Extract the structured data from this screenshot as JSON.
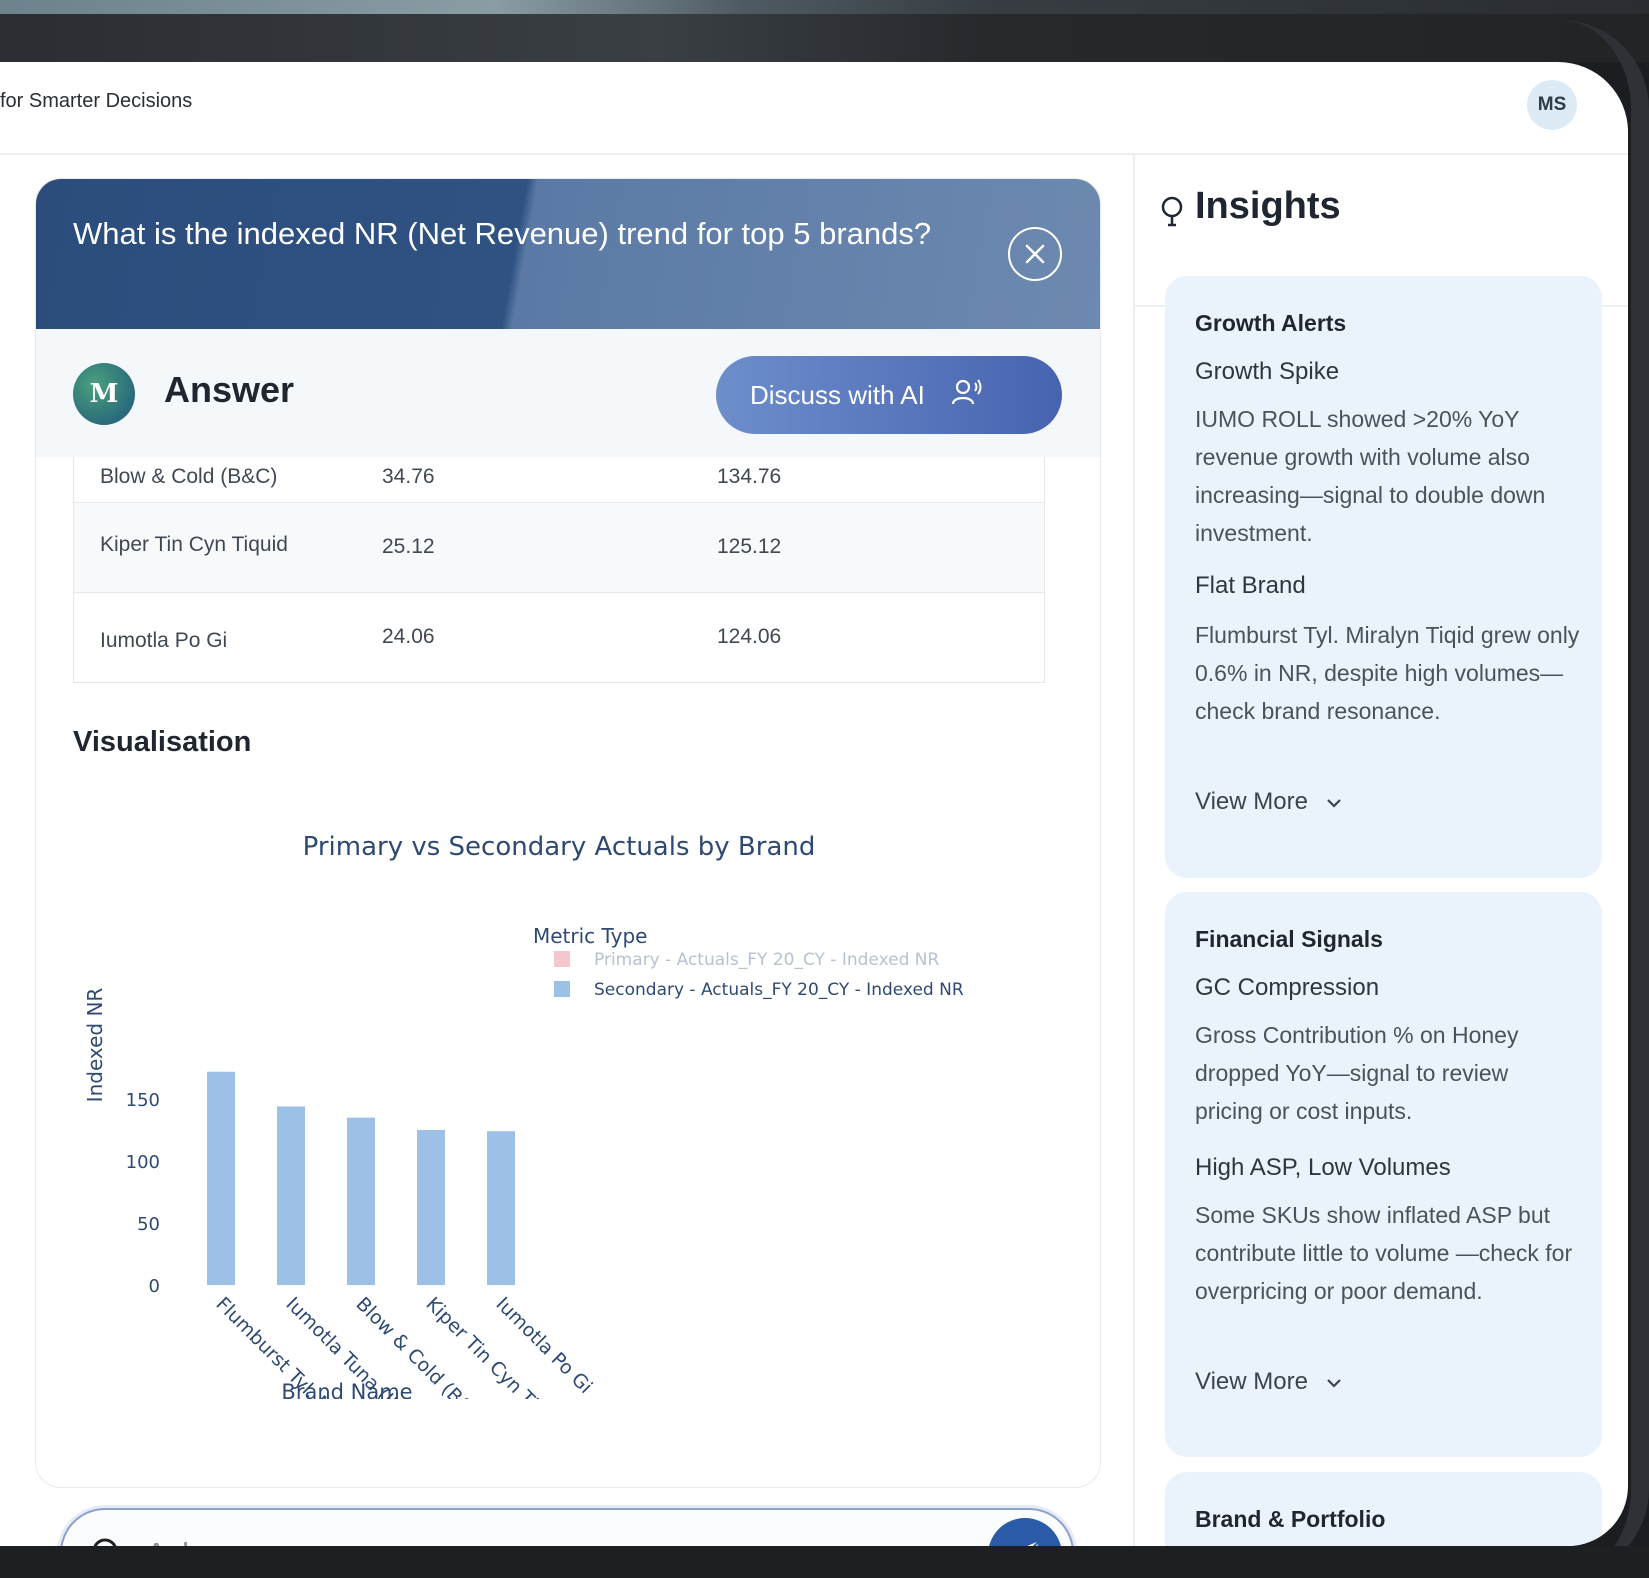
{
  "header": {
    "tagline": "for Smarter Decisions",
    "avatar_initials": "MS"
  },
  "question": {
    "text": "What is the indexed NR (Net Revenue) trend for top 5 brands?"
  },
  "answer": {
    "label": "Answer",
    "logo_letter": "M",
    "discuss_button": "Discuss with AI"
  },
  "table": {
    "rows": [
      [
        "Blow & Cold (B&C)",
        "34.76",
        "134.76"
      ],
      [
        "Kiper Tin Cyn Tiquid",
        "25.12",
        "125.12"
      ],
      [
        "Iumotla Po Gi",
        "24.06",
        "124.06"
      ]
    ]
  },
  "visualisation": {
    "heading": "Visualisation"
  },
  "chart_data": {
    "type": "bar",
    "title": "Primary vs Secondary Actuals by Brand",
    "xlabel": "Brand Name",
    "ylabel": "Indexed NR",
    "categories": [
      "Flumburst Tyl. Miralyn Tiqid",
      "Iumotla Tuna (IUMO TUNA)",
      "Blow & Cold (B&C)",
      "Kiper Tin Cyn Tiquid",
      "Iumotla Po Gi"
    ],
    "yticks": [
      "0",
      "50",
      "100",
      "150"
    ],
    "ylim": [
      0,
      175
    ],
    "legend_title": "Metric Type",
    "series": [
      {
        "name": "Primary - Actuals_FY 20_CY - Indexed NR",
        "color": "#f4c7cc",
        "values": []
      },
      {
        "name": "Secondary - Actuals_FY 20_CY - Indexed NR",
        "color": "#9dc0e6",
        "values": [
          172,
          144,
          135,
          125,
          124
        ]
      }
    ],
    "legend_position": "top-right",
    "grid": false
  },
  "query": {
    "placeholder": "Ask a query..."
  },
  "insights": {
    "title": "Insights",
    "cards": [
      {
        "category": "Growth Alerts",
        "items": [
          {
            "title": "Growth Spike",
            "body": "IUMO ROLL showed >20% YoY revenue growth with volume also increasing—signal to double down investment."
          },
          {
            "title": "Flat Brand",
            "body": "Flumburst Tyl. Miralyn Tiqid grew only 0.6% in NR, despite high volumes—check brand resonance."
          }
        ],
        "more": "View More"
      },
      {
        "category": "Financial Signals",
        "items": [
          {
            "title": "GC Compression",
            "body": "Gross Contribution % on Honey dropped YoY—signal to review pricing or cost inputs."
          },
          {
            "title": "High ASP, Low Volumes",
            "body": "Some SKUs show inflated ASP but contribute little to volume —check for overpricing or poor demand."
          }
        ],
        "more": "View More"
      },
      {
        "category": "Brand & Portfolio"
      }
    ]
  }
}
